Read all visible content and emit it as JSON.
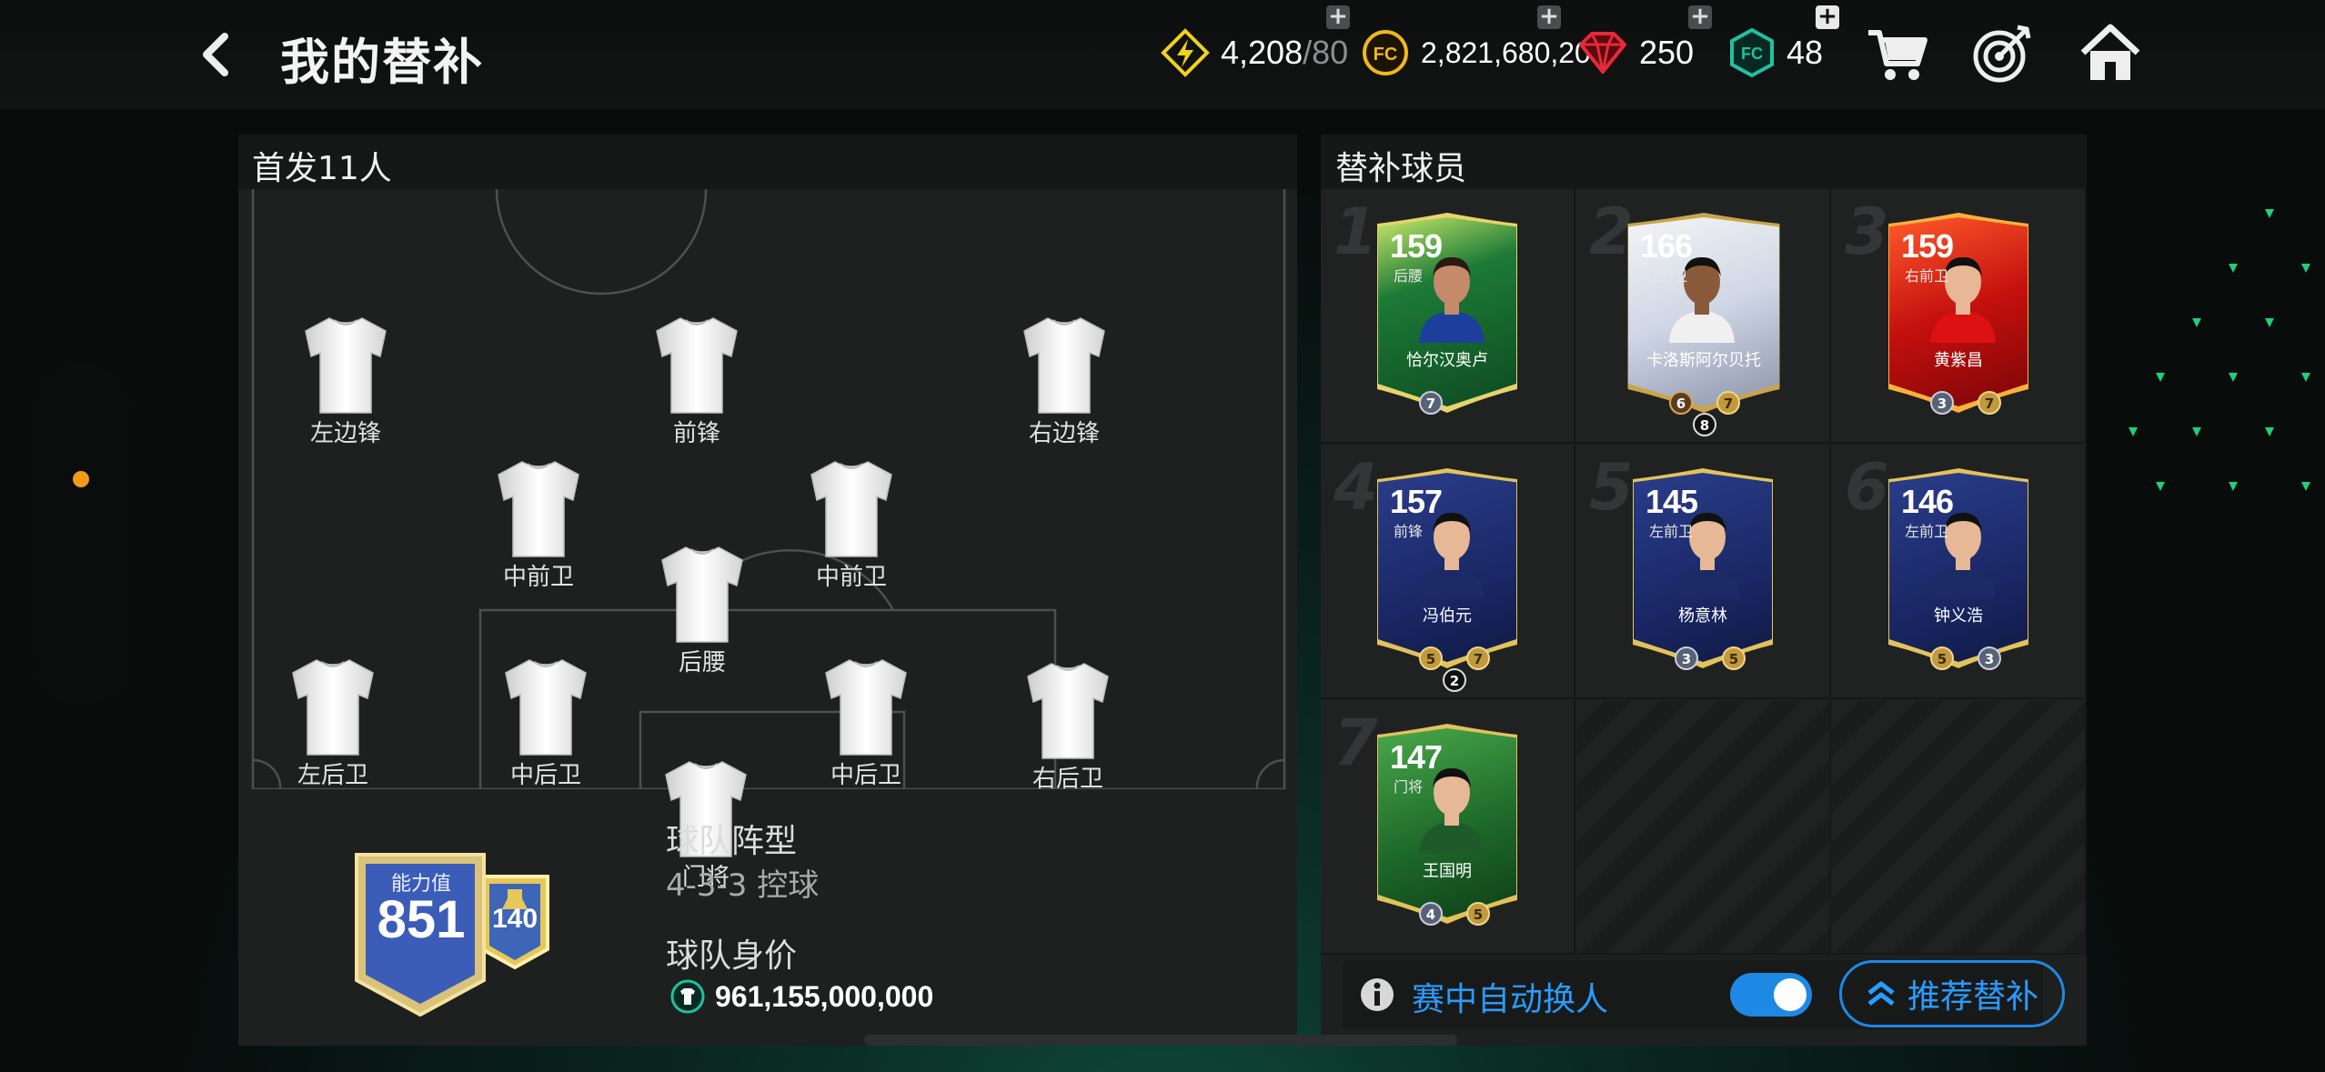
{
  "header": {
    "title": "我的替补"
  },
  "currencies": {
    "energy": {
      "value": "4,208",
      "max": "/80"
    },
    "coins": {
      "value": "2,821,680,201"
    },
    "gems": {
      "value": "250"
    },
    "fc_points": {
      "value": "48"
    }
  },
  "lineup": {
    "title": "首发11人",
    "positions": {
      "lw": "左边锋",
      "st": "前锋",
      "rw": "右边锋",
      "cm1": "中前卫",
      "cm2": "中前卫",
      "cdm": "后腰",
      "lb": "左后卫",
      "cb1": "中后卫",
      "cb2": "中后卫",
      "rb": "右后卫",
      "gk": "门将"
    }
  },
  "team": {
    "ovr_label": "能力值",
    "ovr": "851",
    "chem": "140",
    "formation_label": "球队阵型",
    "formation": "4-3-3 控球",
    "value_label": "球队身价",
    "value": "961,155,000,000"
  },
  "subs": {
    "title": "替补球员",
    "players": [
      {
        "slot": "1",
        "ovr": "159",
        "pos": "后腰",
        "name": "恰尔汉奥卢",
        "b1": "7"
      },
      {
        "slot": "2",
        "ovr": "166",
        "pos": "右边卫",
        "name": "卡洛斯阿尔贝托",
        "b1": "6",
        "b2": "7",
        "b3": "8"
      },
      {
        "slot": "3",
        "ovr": "159",
        "pos": "右前卫",
        "name": "黄紫昌",
        "b1": "3",
        "b2": "7"
      },
      {
        "slot": "4",
        "ovr": "157",
        "pos": "前锋",
        "name": "冯伯元",
        "b1": "5",
        "b2": "7",
        "b3": "2"
      },
      {
        "slot": "5",
        "ovr": "145",
        "pos": "左前卫",
        "name": "杨意林",
        "b1": "3",
        "b2": "5"
      },
      {
        "slot": "6",
        "ovr": "146",
        "pos": "左前卫",
        "name": "钟义浩",
        "b1": "5",
        "b2": "3"
      },
      {
        "slot": "7",
        "ovr": "147",
        "pos": "门将",
        "name": "王国明",
        "b1": "4",
        "b2": "5"
      }
    ],
    "auto_sub_label": "赛中自动换人",
    "recommend_label": "推荐替补"
  }
}
